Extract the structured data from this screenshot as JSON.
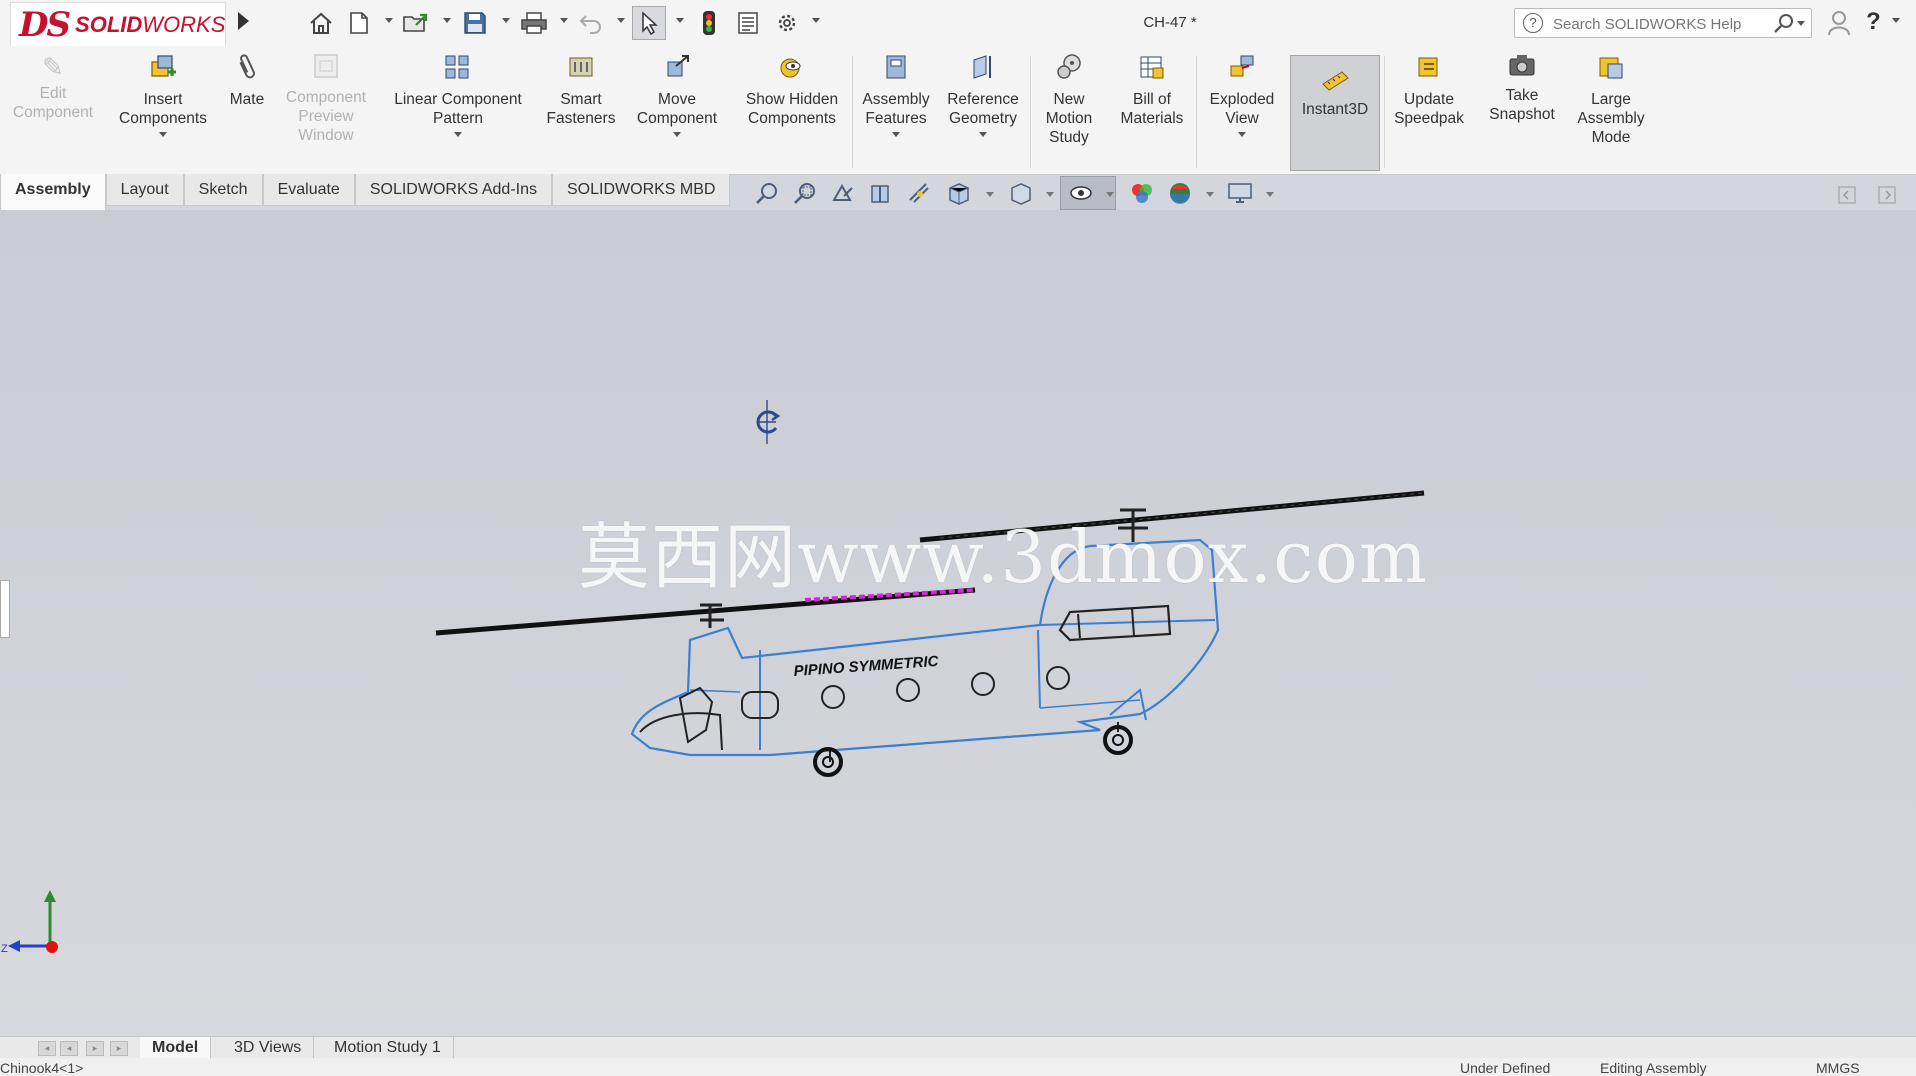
{
  "app": {
    "logo_letters": "DS",
    "logo_text_bold": "SOLID",
    "logo_text": "WORKS",
    "document_title": "CH-47 *"
  },
  "quick_access": {
    "icons": [
      "home-icon",
      "new-document-icon",
      "open-icon",
      "save-icon",
      "print-icon",
      "undo-icon",
      "select-arrow-icon",
      "rebuild-icon",
      "file-properties-icon",
      "options-gear-icon"
    ]
  },
  "search": {
    "placeholder": "Search SOLIDWORKS Help"
  },
  "command_manager": {
    "edit_component": "Edit Component",
    "insert_components": "Insert Components",
    "mate": "Mate",
    "component_preview_window": "Component Preview Window",
    "linear_component_pattern": "Linear Component Pattern",
    "smart_fasteners": "Smart Fasteners",
    "move_component": "Move Component",
    "show_hidden_components": "Show Hidden Components",
    "assembly_features": "Assembly Features",
    "reference_geometry": "Reference Geometry",
    "new_motion_study": "New Motion Study",
    "bill_of_materials": "Bill of Materials",
    "exploded_view": "Exploded View",
    "instant3d": "Instant3D",
    "update_speedpak": "Update Speedpak",
    "take_snapshot": "Take Snapshot",
    "large_assembly_mode": "Large Assembly Mode"
  },
  "tabs": {
    "assembly": "Assembly",
    "layout": "Layout",
    "sketch": "Sketch",
    "evaluate": "Evaluate",
    "addins": "SOLIDWORKS Add-Ins",
    "mbd": "SOLIDWORKS MBD"
  },
  "graphics": {
    "watermark": "莫西网www.3dmox.com",
    "fuselage_label": "PIPINO SYMMETRIC",
    "triad_z": "Z"
  },
  "bottom_tabs": {
    "model": "Model",
    "views3d": "3D Views",
    "motion": "Motion Study 1"
  },
  "status_bar": {
    "selection": "Chinook4<1>",
    "definition": "Under Defined",
    "mode": "Editing Assembly",
    "units": "MMGS"
  },
  "colors": {
    "brand_red": "#c8102e",
    "model_edge_blue": "#3b7fd0",
    "rotor_black": "#111111",
    "highlight_magenta": "#d02ad0"
  }
}
